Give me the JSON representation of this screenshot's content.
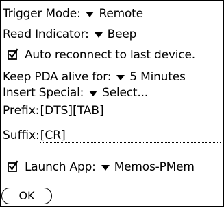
{
  "trigger_mode": {
    "label": "Trigger Mode:",
    "value": "Remote"
  },
  "read_indicator": {
    "label": "Read Indicator:",
    "value": "Beep"
  },
  "auto_reconnect": {
    "label": "Auto reconnect to last device.",
    "checked": true
  },
  "keep_alive": {
    "label": "Keep PDA alive for:",
    "value": "5 Minutes"
  },
  "insert_special": {
    "label": "Insert Special:",
    "value": "Select..."
  },
  "prefix": {
    "label": "Prefix:",
    "value": "[DTS][TAB]"
  },
  "suffix": {
    "label": "Suffix:",
    "value": "[CR]"
  },
  "launch_app": {
    "label": "Launch App:",
    "value": "Memos-PMem",
    "checked": true
  },
  "ok_button": {
    "label": "OK"
  },
  "icons": {
    "dropdown": "triangle-down-icon",
    "checkbox": "checkbox-checked-icon"
  }
}
